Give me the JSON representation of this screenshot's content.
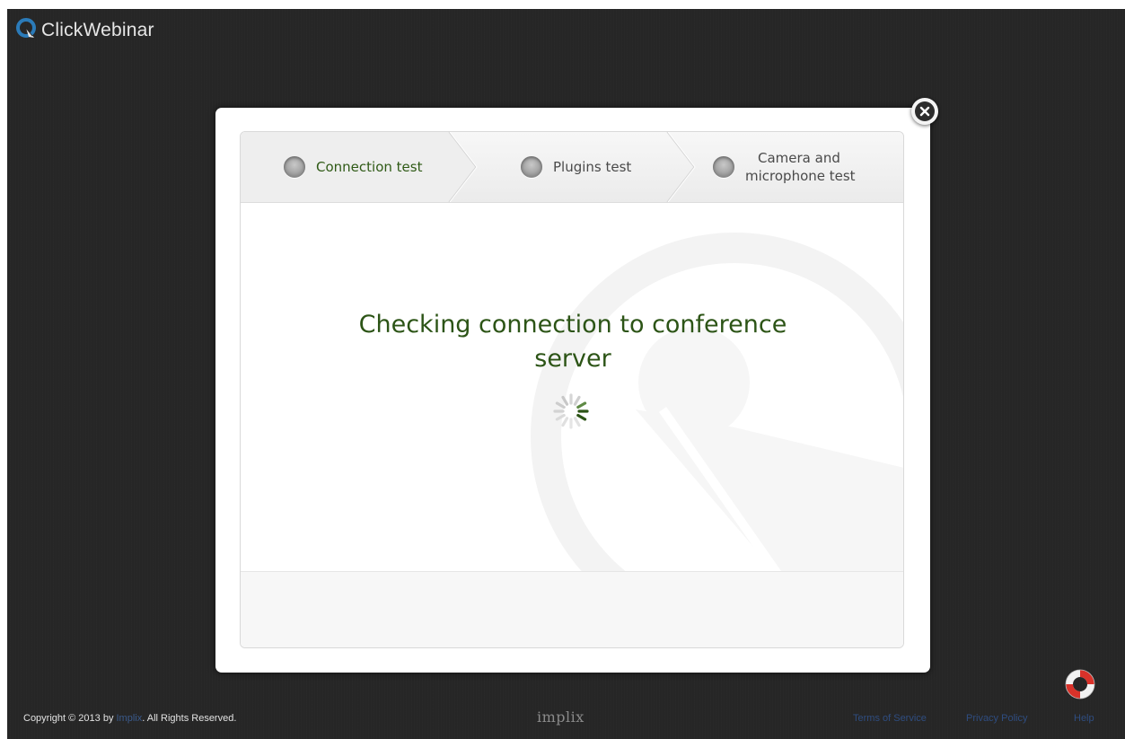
{
  "app": {
    "brand_name": "ClickWebinar",
    "accent_color": "#2c5416",
    "brand_icon": "clickwebinar-logo-icon"
  },
  "modal": {
    "close_icon": "close-icon",
    "steps": [
      {
        "label_lines": [
          "Connection test"
        ],
        "state": "active"
      },
      {
        "label_lines": [
          "Plugins test"
        ],
        "state": "pending"
      },
      {
        "label_lines": [
          "Camera and",
          "microphone test"
        ],
        "state": "pending"
      }
    ],
    "heading": "Checking connection to conference server",
    "loading_icon": "spinner-icon"
  },
  "footer": {
    "copyright_prefix": "Copyright © 2013 by ",
    "copyright_link": "Implix",
    "copyright_suffix": ". All Rights Reserved.",
    "partner_logo": "implix",
    "links": [
      "Terms of Service",
      "Privacy Policy",
      "Help"
    ],
    "help_icon": "lifebuoy-icon"
  }
}
